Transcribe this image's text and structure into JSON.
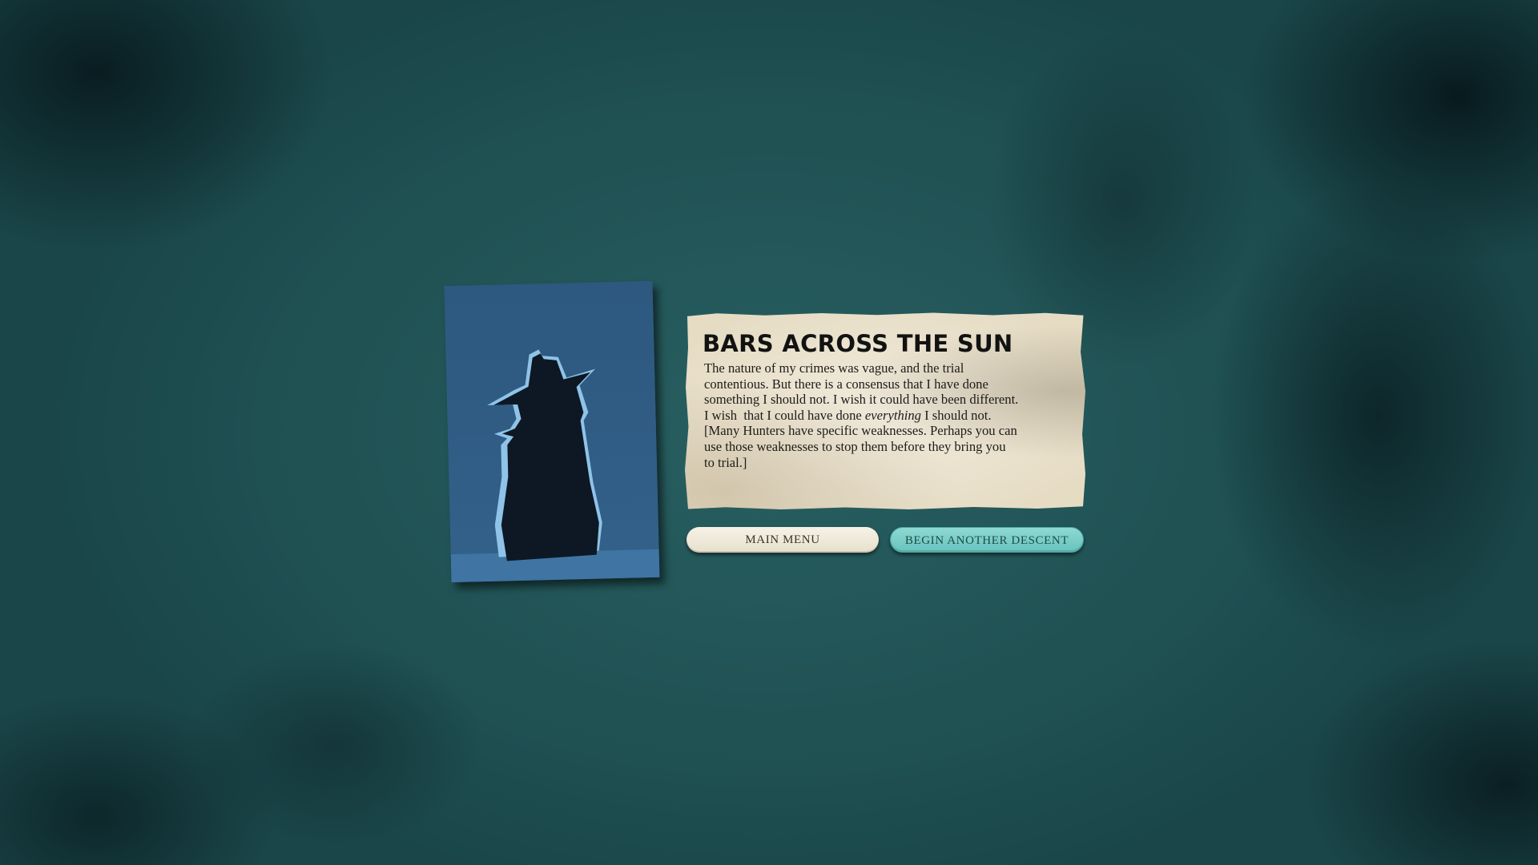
{
  "card": {
    "image": "trenchcoat-hat-silhouette",
    "background_color": "#2e5a82"
  },
  "result": {
    "title": "BARS ACROSS THE SUN",
    "lines": [
      "The nature of my crimes was vague, and the trial",
      "contentious. But there is a consensus that I have done",
      "something I should not. I wish it could have been different.",
      "I wish  that I could have done ",
      "everything",
      " I should not.",
      "[Many Hunters have specific weaknesses. Perhaps you can",
      "use those weaknesses to stop them before they bring you",
      "to trial.]"
    ]
  },
  "buttons": {
    "main_menu": "MAIN MENU",
    "begin_descent": "BEGIN ANOTHER DESCENT"
  },
  "colors": {
    "background": "#285f61",
    "parchment": "#ece4d0",
    "descent_button": "#7ccfc9"
  }
}
